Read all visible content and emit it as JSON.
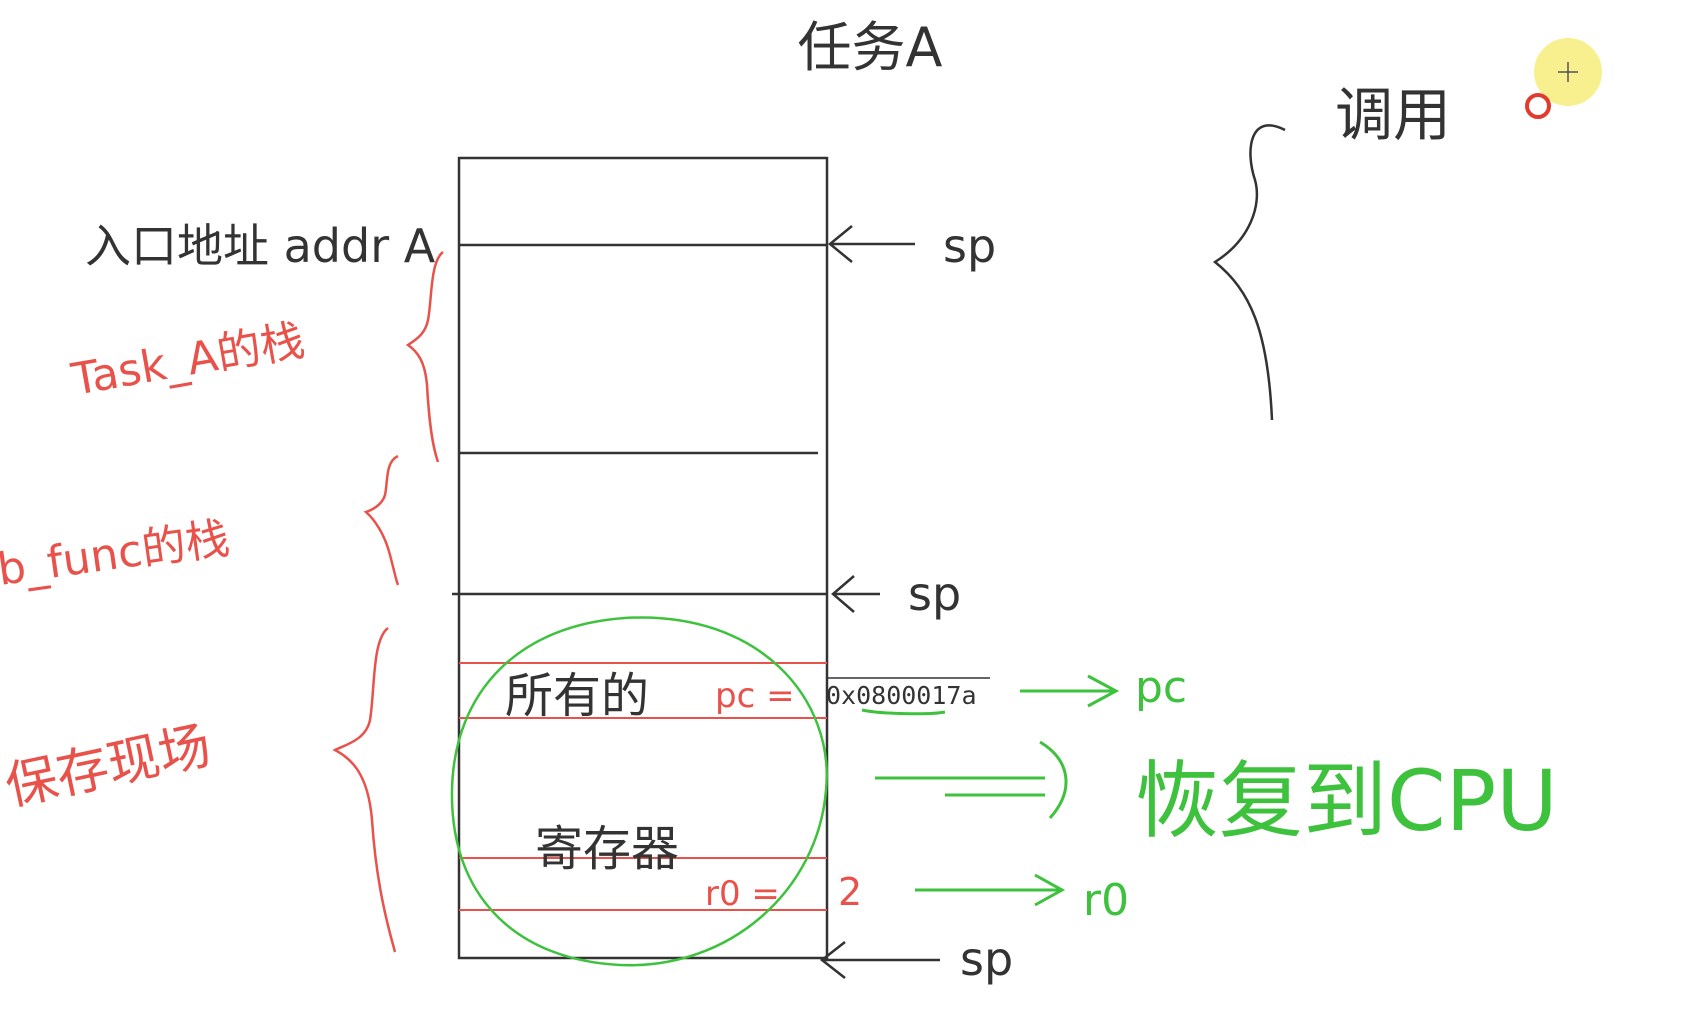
{
  "title": "任务A",
  "annotations": {
    "call": "调用",
    "entry_addr": "入口地址 addr A",
    "task_stack": "Task_A的栈",
    "func_stack": "b_func的栈",
    "save_context": "保存现场",
    "all": "所有的",
    "registers": "寄存器",
    "pc_label": "pc =",
    "pc_value": "0x0800017a",
    "r0_label": "r0 =",
    "r0_value": "2",
    "sp_1": "sp",
    "sp_2": "sp",
    "sp_3": "sp",
    "pc_target": "pc",
    "r0_target": "r0",
    "restore": "恢复到CPU"
  },
  "colors": {
    "ink": "#333333",
    "red": "#e8524a",
    "green": "#3ec23e",
    "highlight": "#f5ea6a",
    "dot": "#e23b2e"
  }
}
